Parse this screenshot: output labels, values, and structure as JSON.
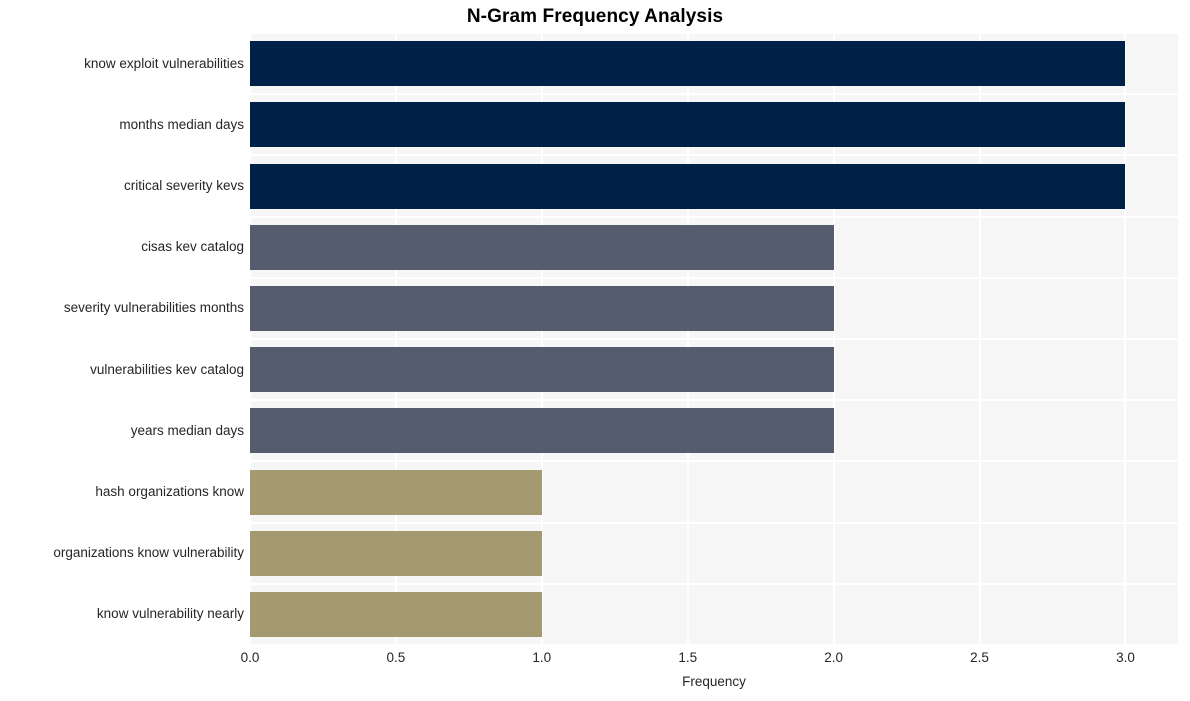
{
  "chart_data": {
    "type": "bar",
    "orientation": "horizontal",
    "title": "N-Gram Frequency Analysis",
    "xlabel": "Frequency",
    "ylabel": "",
    "xlim": [
      0,
      3.18
    ],
    "xticks": [
      "0.0",
      "0.5",
      "1.0",
      "1.5",
      "2.0",
      "2.5",
      "3.0"
    ],
    "xtick_values": [
      0.0,
      0.5,
      1.0,
      1.5,
      2.0,
      2.5,
      3.0
    ],
    "grid": true,
    "legend": "none",
    "categories": [
      "know exploit vulnerabilities",
      "months median days",
      "critical severity kevs",
      "cisas kev catalog",
      "severity vulnerabilities months",
      "vulnerabilities kev catalog",
      "years median days",
      "hash organizations know",
      "organizations know vulnerability",
      "know vulnerability nearly"
    ],
    "values": [
      3,
      3,
      3,
      2,
      2,
      2,
      2,
      1,
      1,
      1
    ],
    "bar_colors": [
      "#002147",
      "#002147",
      "#002147",
      "#555c6e",
      "#555c6e",
      "#555c6e",
      "#555c6e",
      "#a49a72",
      "#a49a72",
      "#a49a72"
    ]
  },
  "style": {
    "plot_background": "#f6f6f7",
    "figure_background": "#ffffff",
    "grid_color": "#ffffff",
    "text_color": "#262626",
    "title_color": "#000000"
  }
}
